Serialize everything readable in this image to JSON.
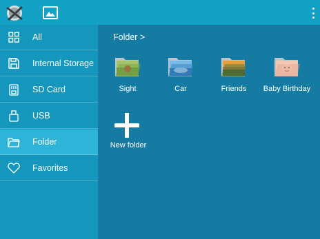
{
  "topbar": {
    "logo_icon": "app-logo-icon",
    "gallery_icon": "image-icon",
    "overflow_icon": "more-vertical-icon"
  },
  "sidebar": {
    "items": [
      {
        "label": "All",
        "icon": "grid-icon",
        "active": false
      },
      {
        "label": "Internal Storage",
        "icon": "floppy-icon",
        "active": false
      },
      {
        "label": "SD Card",
        "icon": "sd-card-icon",
        "active": false
      },
      {
        "label": "USB",
        "icon": "usb-icon",
        "active": false
      },
      {
        "label": "Folder",
        "icon": "folder-icon",
        "active": true
      },
      {
        "label": "Favorites",
        "icon": "heart-icon",
        "active": false
      }
    ]
  },
  "main": {
    "breadcrumb": "Folder >",
    "folders": [
      {
        "label": "Sight"
      },
      {
        "label": "Car"
      },
      {
        "label": "Friends"
      },
      {
        "label": "Baby Birthday"
      }
    ],
    "new_folder_label": "New folder"
  },
  "colors": {
    "topbar": "#14a1c6",
    "sidebar": "#1596bd",
    "sidebar_active": "#2eb4d8",
    "content": "#167ba3"
  }
}
